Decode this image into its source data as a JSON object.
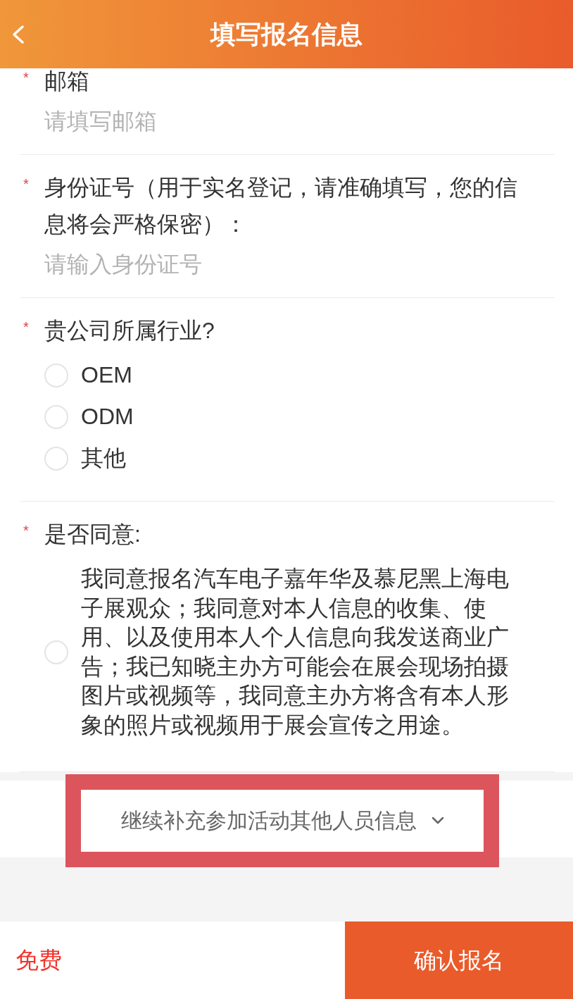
{
  "header": {
    "title": "填写报名信息"
  },
  "fields": [
    {
      "kind": "input",
      "required_mark": "*",
      "label": "邮箱",
      "placeholder": "请填写邮箱"
    },
    {
      "kind": "input",
      "required_mark": "*",
      "label": "身份证号（用于实名登记，请准确填写，您的信息将会严格保密）：",
      "placeholder": "请输入身份证号"
    },
    {
      "kind": "choice",
      "required_mark": "*",
      "label": "贵公司所属行业?",
      "options": [
        {
          "label": "OEM",
          "selected": false
        },
        {
          "label": "ODM",
          "selected": false
        },
        {
          "label": "其他",
          "selected": false
        }
      ]
    },
    {
      "kind": "choice",
      "required_mark": "*",
      "label": "是否同意:",
      "options": [
        {
          "label": "我同意报名汽车电子嘉年华及慕尼黑上海电子展观众；我同意对本人信息的收集、使用、以及使用本人个人信息向我发送商业广告；我已知晓主办方可能会在展会现场拍摄图片或视频等，我同意主办方将含有本人形象的照片或视频用于展会宣传之用途。",
          "selected": false
        }
      ]
    }
  ],
  "expand_button": {
    "label": "继续补充参加活动其他人员信息",
    "highlighted": true
  },
  "footer": {
    "price": "免费",
    "submit": "确认报名"
  }
}
